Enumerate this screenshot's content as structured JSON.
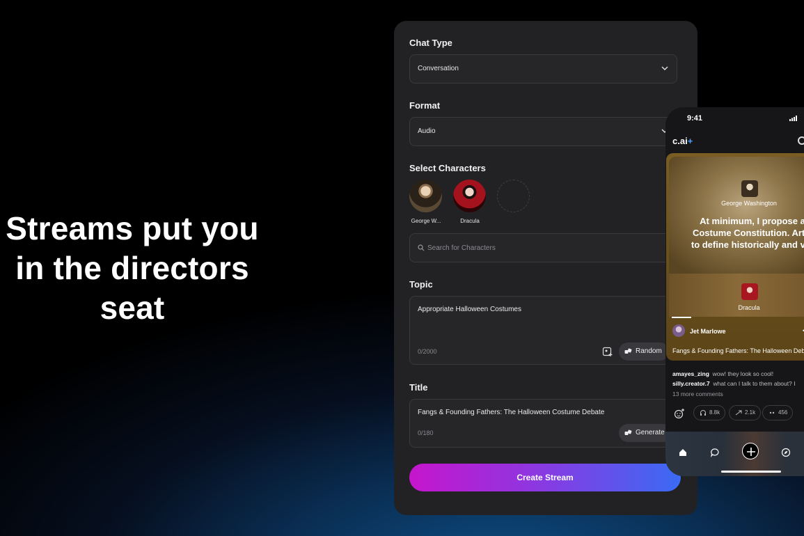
{
  "hero": {
    "line1": "Streams put you",
    "line2": "in the directors",
    "line3": "seat"
  },
  "form": {
    "chat_type": {
      "label": "Chat Type",
      "value": "Conversation"
    },
    "format": {
      "label": "Format",
      "value": "Audio"
    },
    "characters": {
      "label": "Select Characters",
      "items": [
        {
          "name": "George W..."
        },
        {
          "name": "Dracula"
        }
      ],
      "search_placeholder": "Search for Characters"
    },
    "topic": {
      "label": "Topic",
      "value": "Appropriate Halloween Costumes",
      "count": "0/2000",
      "random_label": "Random"
    },
    "title": {
      "label": "Title",
      "value": "Fangs & Founding Fathers: The Halloween Costume Debate",
      "count": "0/180",
      "generate_label": "Generate"
    },
    "create_label": "Create Stream"
  },
  "phone": {
    "time": "9:41",
    "logo": "c.ai",
    "logo_plus": "+",
    "stream": {
      "speaker_top": "George Washington",
      "quote_lines": [
        "At minimum, I propose a",
        "Costume Constitution. Artic",
        "to define historically and var"
      ],
      "speaker_bottom": "Dracula",
      "creator": "Jet Marlowe",
      "title": "Fangs & Founding Fathers: The Halloween Debate"
    },
    "comments": [
      {
        "user": "amayes_zing",
        "text": "wow! they look so cool!"
      },
      {
        "user": "silly.creator.7",
        "text": "what can I talk to them about? I"
      }
    ],
    "more_comments": "13 more comments",
    "reactions": [
      "8.8k",
      "2.1k",
      "456"
    ]
  },
  "colors": {
    "accent_start": "#c615cc",
    "accent_end": "#3a6bf4",
    "card_bg": "#222225",
    "feed_gold": "#7a5d22"
  }
}
